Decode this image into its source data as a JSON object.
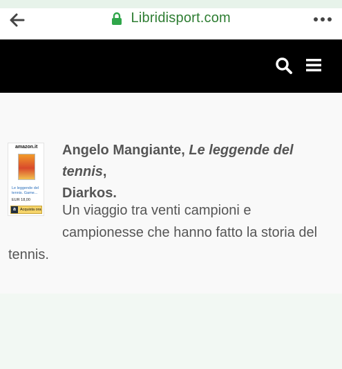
{
  "browser": {
    "domain": "Libridisport.com",
    "icons": {
      "back": "arrow-left-icon",
      "lock": "lock-icon",
      "more": "more-dots-icon"
    },
    "colors": {
      "strip": "#e7f3ea",
      "domain": "#2e7d32",
      "lock": "#2fa64a"
    }
  },
  "site": {
    "icons": {
      "search": "search-icon",
      "menu": "hamburger-menu-icon"
    },
    "colors": {
      "nav": "#000000"
    }
  },
  "article": {
    "author": "Angelo Mangiante,",
    "book_title": "Le leggende del tennis",
    "publisher_suffix": ",",
    "publisher": "Diarkos.",
    "paragraph_line1": "Un viaggio tra venti campioni e",
    "paragraph_line2": "campionesse che hanno fatto la storia del",
    "paragraph_line3": "tennis."
  },
  "ad": {
    "brand": "amazon.it",
    "title": "Le leggende del tennis. Game...",
    "price": "EUR 18,00",
    "button_icon": "a",
    "button_label": "Acquista ora"
  }
}
